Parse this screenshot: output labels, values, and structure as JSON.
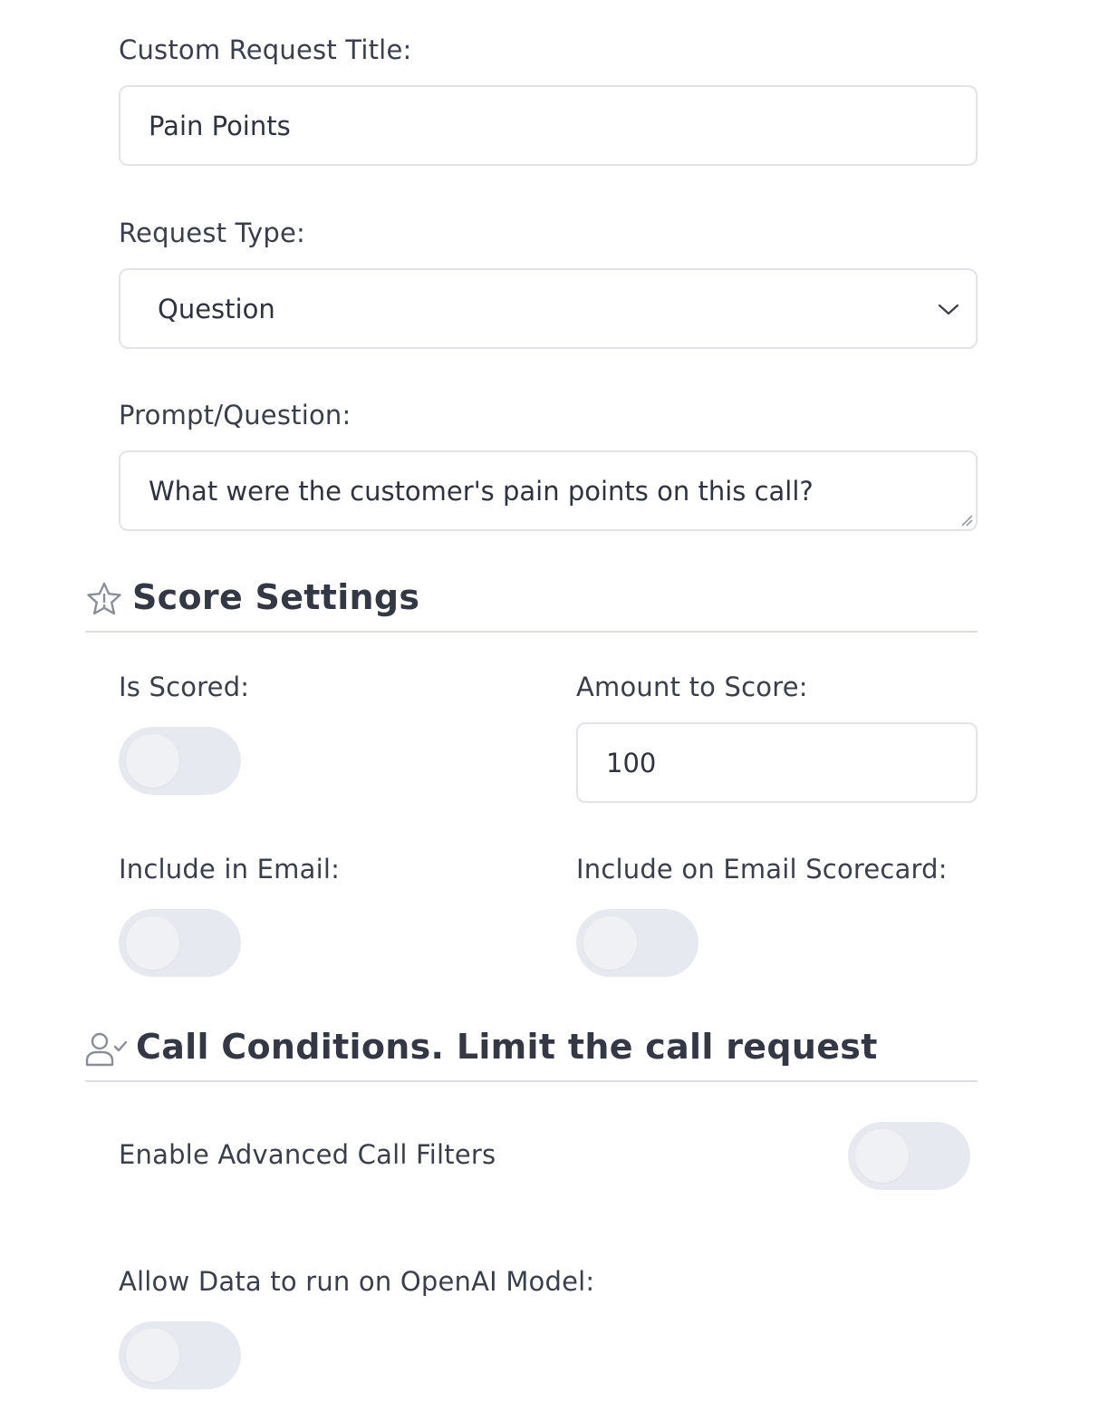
{
  "form": {
    "title_label": "Custom Request Title:",
    "title_value": "Pain Points",
    "type_label": "Request Type:",
    "type_value": "Question",
    "prompt_label": "Prompt/Question:",
    "prompt_value": "What were the customer's pain points on this call?"
  },
  "score_settings": {
    "heading": "Score Settings",
    "heading_icon": "star-icon",
    "is_scored_label": "Is Scored:",
    "is_scored": false,
    "amount_label": "Amount to Score:",
    "amount_value": "100",
    "include_email_label": "Include in Email:",
    "include_email": false,
    "include_scorecard_label": "Include on Email Scorecard:",
    "include_scorecard": false
  },
  "call_conditions": {
    "heading": "Call Conditions. Limit the call request",
    "heading_icon": "user-check-icon",
    "advanced_filters_label": "Enable Advanced Call Filters",
    "advanced_filters": false,
    "openai_label": "Allow Data to run on OpenAI Model:",
    "openai": false
  },
  "colors": {
    "text": "#3a3f4b",
    "border": "#e3e4ea",
    "toggle_off": "#e6e9f0",
    "divider": "#dcdee4"
  }
}
